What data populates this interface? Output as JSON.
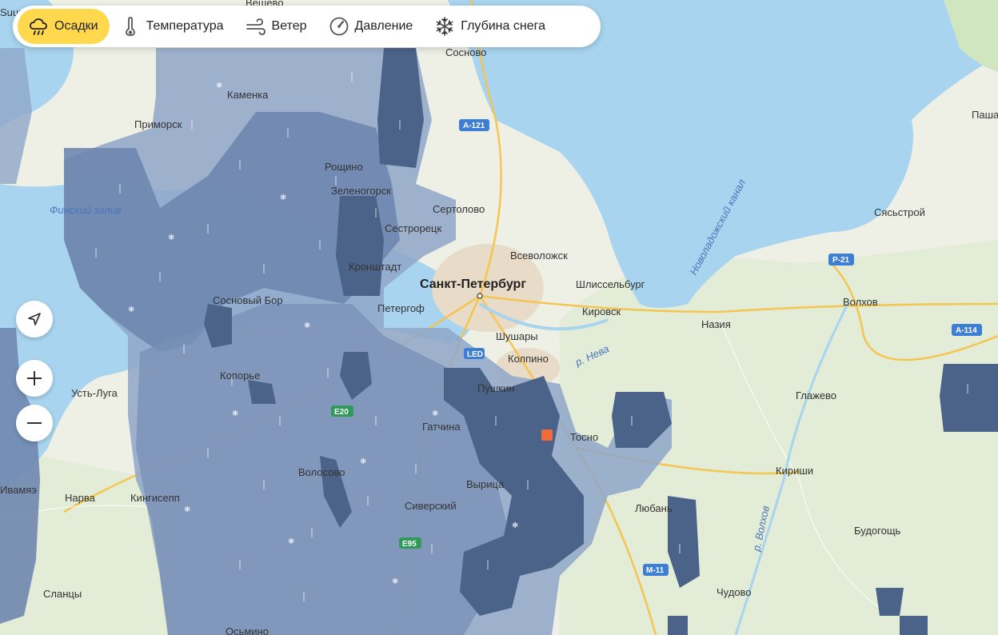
{
  "toolbar": {
    "tabs": [
      {
        "label": "Осадки",
        "icon": "rain-cloud-icon",
        "active": true
      },
      {
        "label": "Температура",
        "icon": "thermometer-icon",
        "active": false
      },
      {
        "label": "Ветер",
        "icon": "wind-icon",
        "active": false
      },
      {
        "label": "Давление",
        "icon": "pressure-gauge-icon",
        "active": false
      },
      {
        "label": "Глубина снега",
        "icon": "snowflake-icon",
        "active": false
      }
    ]
  },
  "controls": {
    "locate": "navigation-arrow-icon",
    "zoom_in": "plus-icon",
    "zoom_out": "minus-icon"
  },
  "map": {
    "colors": {
      "water": "#a8d4ef",
      "land": "#eef0e6",
      "forest": "#dde9cf",
      "city": "#e8dcc8",
      "precip_light": "#8ea6c8",
      "precip_medium": "#6f87b0",
      "precip_heavy": "#4b6289",
      "active_tab": "#ffd84d",
      "road": "#f6c34a"
    },
    "labels": {
      "city_main": "Санкт-Петербург",
      "sosnovo": "Сосново",
      "kamenka": "Каменка",
      "primorsk": "Приморск",
      "roshchino": "Рощино",
      "zelenogorsk": "Зеленогорск",
      "sertolovo": "Сертолово",
      "sestroretsk": "Сестрорецк",
      "vsevolozhsk": "Всеволожск",
      "kronshtadt": "Кронштадт",
      "shlisselburg": "Шлиссельбург",
      "sosnovy_bor": "Сосновый Бор",
      "petergof": "Петергоф",
      "kirovsk": "Кировск",
      "shushary": "Шушары",
      "kolpino": "Колпино",
      "pushkin": "Пушкин",
      "koporye": "Копорье",
      "ust_luga": "Усть-Луга",
      "gatchina": "Гатчина",
      "tosno": "Тосно",
      "volosovo": "Волосово",
      "vyritsa": "Вырица",
      "narva": "Нарва",
      "kingisepp": "Кингисепп",
      "siversky": "Сиверский",
      "lyuban": "Любань",
      "slantsy": "Сланцы",
      "chudovo": "Чудово",
      "nazia": "Назия",
      "volkhov": "Волхов",
      "syasstroy": "Сясьстрой",
      "glazhevo": "Глажево",
      "kirishi": "Кириши",
      "budogoshch": "Будогощь",
      "pasha": "Паша",
      "finsky_zaliv": "Финский залив",
      "novoladozhsky": "Новоладожский канал",
      "r_neva": "р. Нева",
      "r_volkhov": "р. Волхов",
      "led": "LED",
      "vyshevo": "Вешево",
      "suur": "Suur",
      "a121": "А-121",
      "r21": "Р-21",
      "a114": "А-114",
      "m11": "М-11",
      "e20": "E20",
      "e95": "E95",
      "ivangorod": "Ивамяэ",
      "osmino": "Осьмино"
    }
  }
}
